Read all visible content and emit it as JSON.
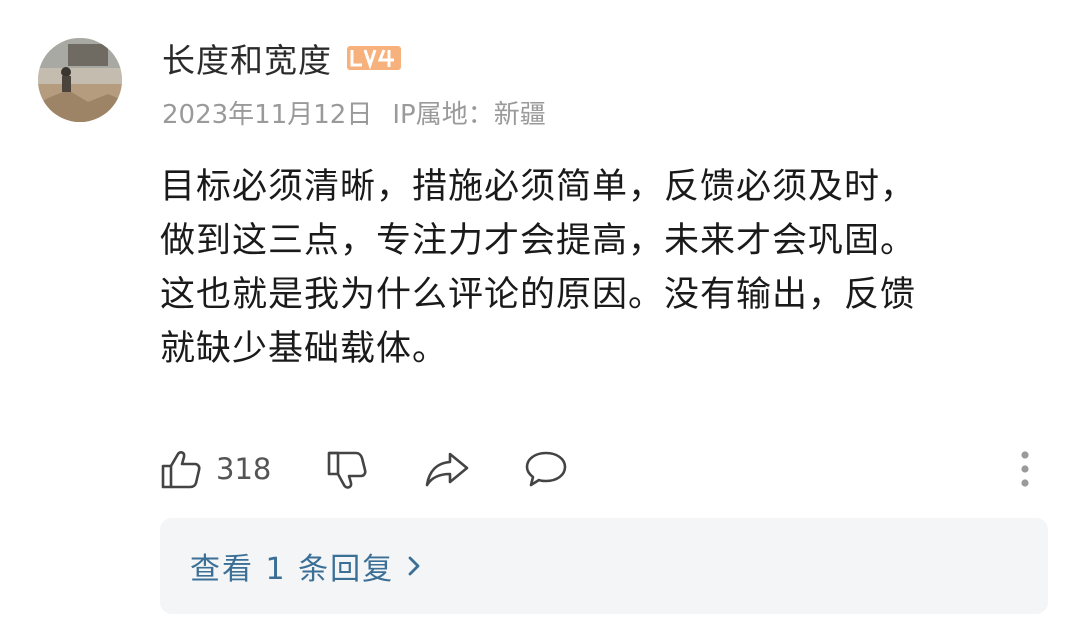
{
  "comment": {
    "username": "长度和宽度",
    "level_badge": "LV4",
    "date": "2023年11月12日",
    "ip_location": "IP属地：新疆",
    "body_lines": [
      "目标必须清晰，措施必须简单，反馈必须及时，",
      "做到这三点，专注力才会提高，未来才会巩固。",
      "这也就是我为什么评论的原因。没有输出，反馈",
      "就缺少基础载体。"
    ]
  },
  "actions": {
    "like_count": "318",
    "icons": [
      "thumbs-up-icon",
      "thumbs-down-icon",
      "share-icon",
      "comment-icon",
      "more-vertical-icon"
    ]
  },
  "replies": {
    "label": "查看 1 条回复"
  },
  "colors": {
    "username": "#2b2b2b",
    "meta": "#9a9a9a",
    "body": "#1a1a1a",
    "badge": "#f6b17c",
    "replies_link": "#3b6f96",
    "replies_bg": "#f3f5f6"
  }
}
